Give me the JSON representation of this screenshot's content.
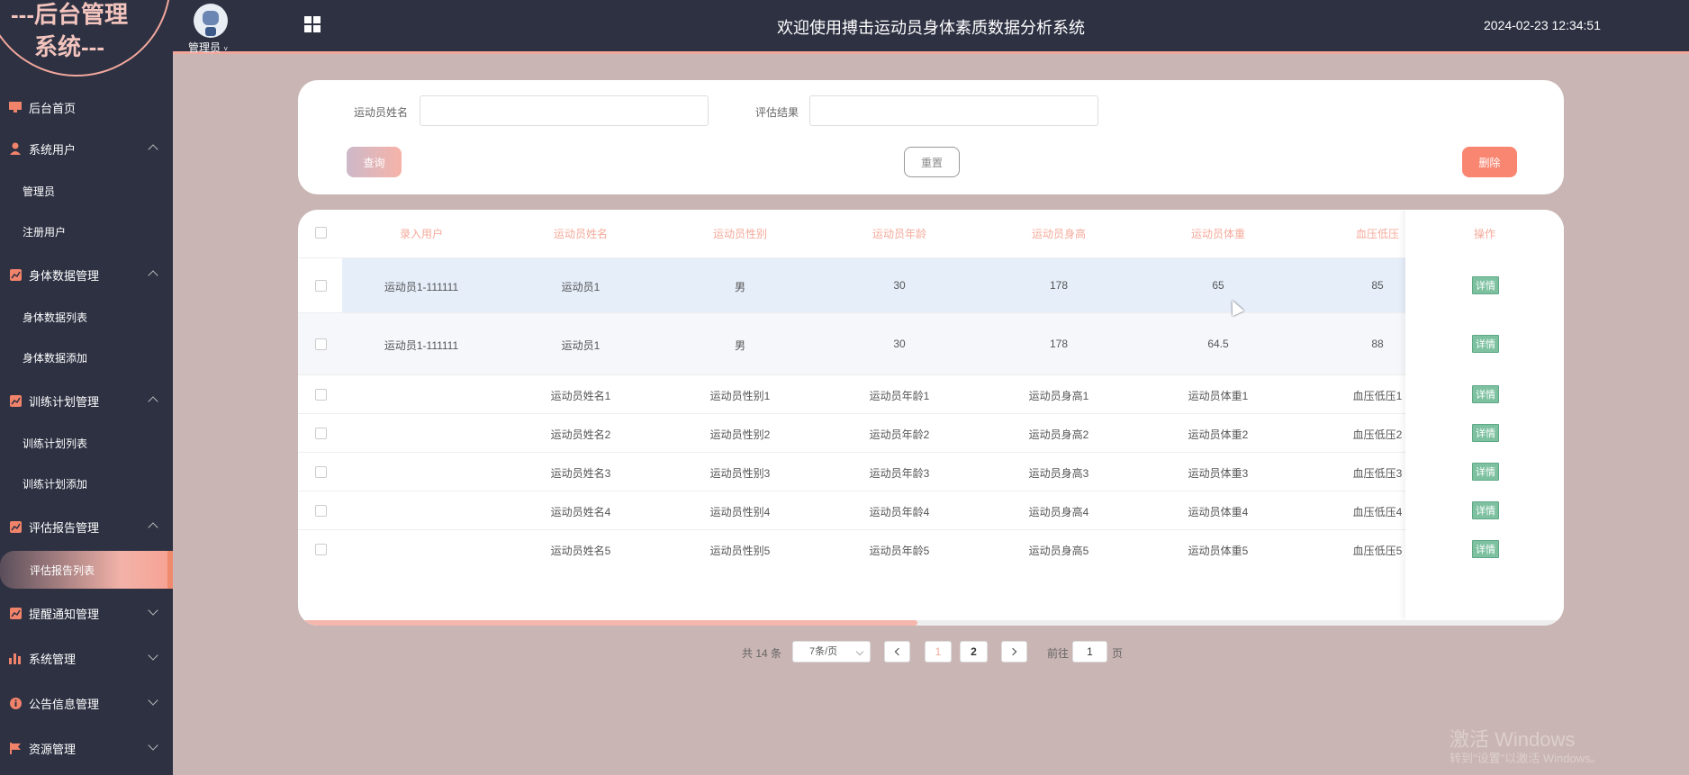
{
  "sidebar": {
    "logo_line1": "---后台管理",
    "logo_line2": "系统---",
    "items": [
      {
        "label": "后台首页"
      },
      {
        "label": "系统用户",
        "subs": [
          "管理员",
          "注册用户"
        ]
      },
      {
        "label": "身体数据管理",
        "subs": [
          "身体数据列表",
          "身体数据添加"
        ]
      },
      {
        "label": "训练计划管理",
        "subs": [
          "训练计划列表",
          "训练计划添加"
        ]
      },
      {
        "label": "评估报告管理",
        "subs": [
          "评估报告列表"
        ]
      },
      {
        "label": "提醒通知管理"
      },
      {
        "label": "系统管理"
      },
      {
        "label": "公告信息管理"
      },
      {
        "label": "资源管理"
      }
    ]
  },
  "header": {
    "user_label": "管理员",
    "title": "欢迎使用搏击运动员身体素质数据分析系统",
    "datetime": "2024-02-23 12:34:51"
  },
  "search": {
    "name_label": "运动员姓名",
    "name_value": "",
    "result_label": "评估结果",
    "result_value": "",
    "query_label": "查询",
    "reset_label": "重置",
    "delete_label": "删除"
  },
  "table": {
    "headers": [
      "录入用户",
      "运动员姓名",
      "运动员性别",
      "运动员年龄",
      "运动员身高",
      "运动员体重",
      "血压低压",
      "操作"
    ],
    "rows": [
      [
        "运动员1-111111",
        "运动员1",
        "男",
        "30",
        "178",
        "65",
        "85"
      ],
      [
        "运动员1-111111",
        "运动员1",
        "男",
        "30",
        "178",
        "64.5",
        "88"
      ],
      [
        "",
        "运动员姓名1",
        "运动员性别1",
        "运动员年龄1",
        "运动员身高1",
        "运动员体重1",
        "血压低压1"
      ],
      [
        "",
        "运动员姓名2",
        "运动员性别2",
        "运动员年龄2",
        "运动员身高2",
        "运动员体重2",
        "血压低压2"
      ],
      [
        "",
        "运动员姓名3",
        "运动员性别3",
        "运动员年龄3",
        "运动员身高3",
        "运动员体重3",
        "血压低压3"
      ],
      [
        "",
        "运动员姓名4",
        "运动员性别4",
        "运动员年龄4",
        "运动员身高4",
        "运动员体重4",
        "血压低压4"
      ],
      [
        "",
        "运动员姓名5",
        "运动员性别5",
        "运动员年龄5",
        "运动员身高5",
        "运动员体重5",
        "血压低压5"
      ]
    ],
    "detail_label": "详情"
  },
  "pagination": {
    "total": "共 14 条",
    "page_size": "7条/页",
    "pages": [
      "1",
      "2"
    ],
    "goto_prefix": "前往",
    "goto_value": "1",
    "goto_suffix": "页"
  },
  "watermark": {
    "line1": "激活 Windows",
    "line2": "转到\"设置\"以激活 Windows。"
  },
  "colors": {
    "sidebar_bg": "#2d3142",
    "accent": "#f2a79c",
    "header_text": "#f4a99a",
    "detail_btn": "#7ec1a1",
    "delete_btn": "#f88671"
  }
}
